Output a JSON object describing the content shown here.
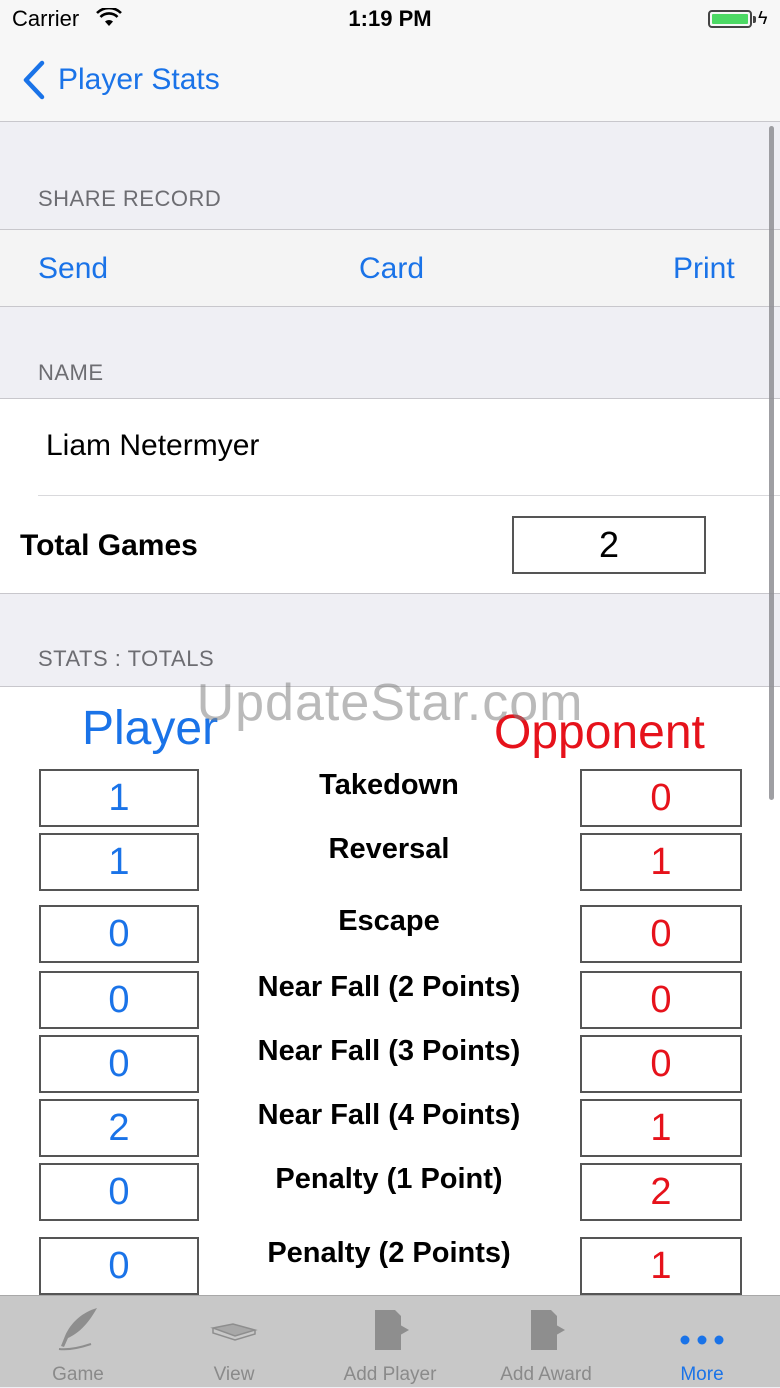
{
  "status_bar": {
    "carrier": "Carrier",
    "time": "1:19 PM"
  },
  "nav": {
    "back_label": "Player Stats"
  },
  "share": {
    "header": "SHARE RECORD",
    "buttons": [
      "Send",
      "Card",
      "Print"
    ]
  },
  "name_section": {
    "header": "NAME",
    "name": "Liam Netermyer",
    "total_games_label": "Total Games",
    "total_games_value": "2"
  },
  "stats": {
    "header": "STATS : TOTALS",
    "watermark": "UpdateStar.com",
    "player_header": "Player",
    "opponent_header": "Opponent",
    "rows": [
      {
        "label": "Takedown",
        "player": "1",
        "opponent": "0"
      },
      {
        "label": "Reversal",
        "player": "1",
        "opponent": "1"
      },
      {
        "label": "Escape",
        "player": "0",
        "opponent": "0"
      },
      {
        "label": "Near Fall (2 Points)",
        "player": "0",
        "opponent": "0"
      },
      {
        "label": "Near Fall (3 Points)",
        "player": "0",
        "opponent": "0"
      },
      {
        "label": "Near Fall (4 Points)",
        "player": "2",
        "opponent": "1"
      },
      {
        "label": "Penalty (1 Point)",
        "player": "0",
        "opponent": "2"
      },
      {
        "label": "Penalty (2 Points)",
        "player": "0",
        "opponent": "1"
      }
    ]
  },
  "tabs": [
    {
      "label": "Game",
      "icon": "quill-icon"
    },
    {
      "label": "View",
      "icon": "book-icon"
    },
    {
      "label": "Add Player",
      "icon": "document-arrow-icon"
    },
    {
      "label": "Add Award",
      "icon": "document-arrow-icon"
    },
    {
      "label": "More",
      "icon": "more-dots-icon"
    }
  ],
  "colors": {
    "accent": "#1a73e8",
    "opponent": "#e6121b",
    "battery": "#4cd964"
  }
}
